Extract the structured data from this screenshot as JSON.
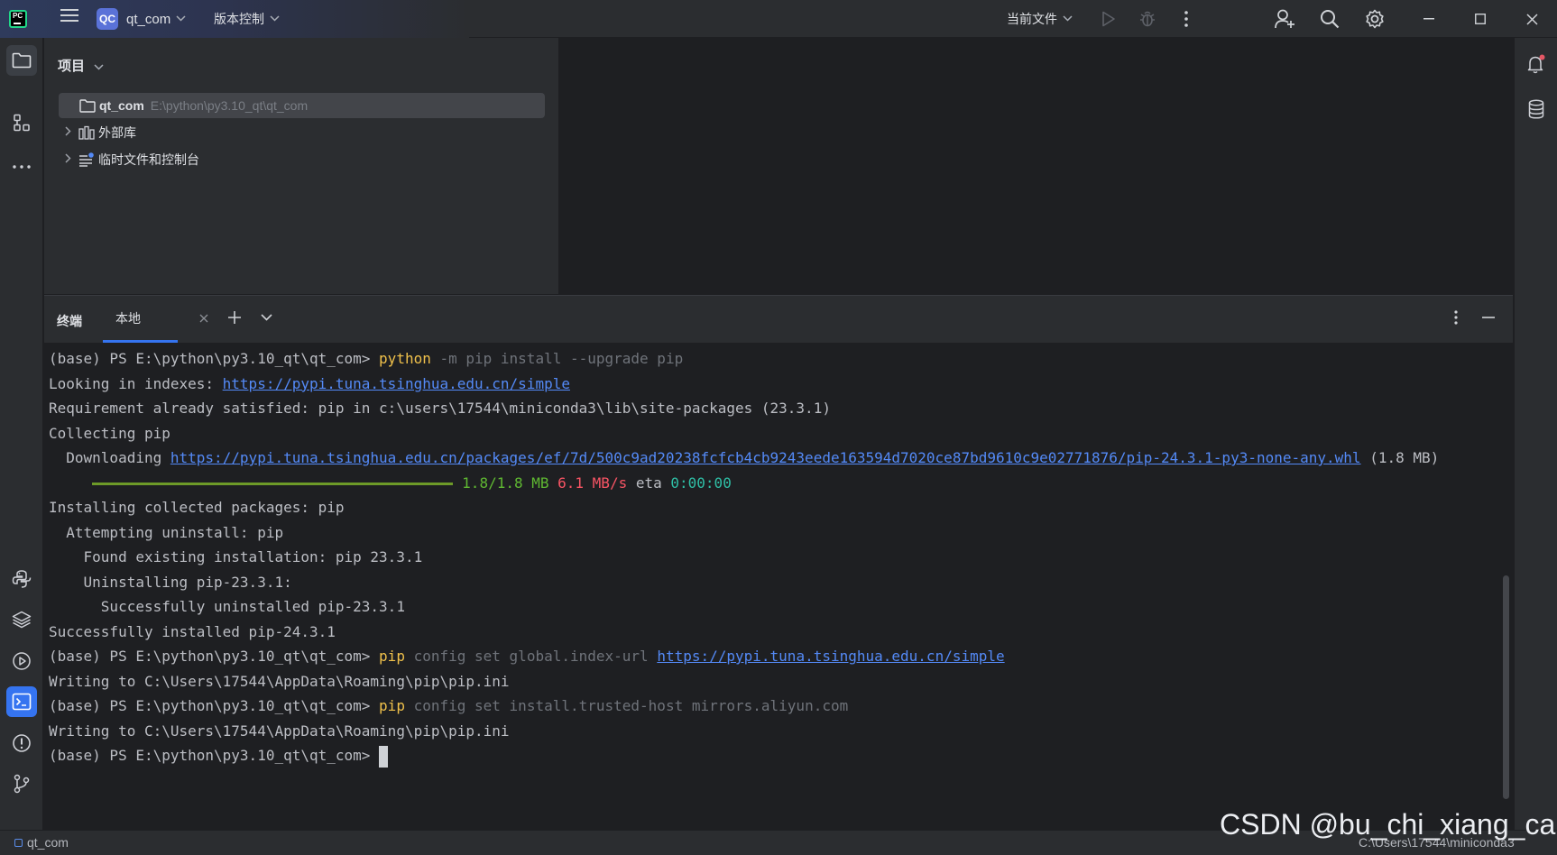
{
  "titlebar": {
    "project_badge": "QC",
    "project_name": "qt_com",
    "vcs_label": "版本控制",
    "current_file_label": "当前文件"
  },
  "project_panel": {
    "title": "项目",
    "tree": [
      {
        "label": "qt_com",
        "path": "E:\\python\\py3.10_qt\\qt_com"
      },
      {
        "label": "外部库"
      },
      {
        "label": "临时文件和控制台"
      }
    ]
  },
  "terminal": {
    "title": "终端",
    "tab_label": "本地",
    "lines": [
      {
        "prompt": "(base) PS E:\\python\\py3.10_qt\\qt_com> ",
        "cmd": "python",
        "args1": " -m ",
        "args2": "pip install ",
        "args3": "--upgrade",
        "args4": " pip"
      },
      {
        "prefix": "Looking in indexes: ",
        "link": "https://pypi.tuna.tsinghua.edu.cn/simple"
      },
      {
        "text": "Requirement already satisfied: pip in c:\\users\\17544\\miniconda3\\lib\\site-packages (23.3.1)"
      },
      {
        "text": "Collecting pip"
      },
      {
        "prefix": "  Downloading ",
        "link": "https://pypi.tuna.tsinghua.edu.cn/packages/ef/7d/500c9ad20238fcfcb4cb9243eede163594d7020ce87bd9610c9e02771876/pip-24.3.1-py3-none-any.whl",
        "suffix": " (1.8 MB)"
      },
      {
        "size": "1.8/1.8 MB",
        "speed": "6.1 MB/s",
        "eta_label": "eta",
        "eta": "0:00:00"
      },
      {
        "text": "Installing collected packages: pip"
      },
      {
        "text": "  Attempting uninstall: pip"
      },
      {
        "text": "    Found existing installation: pip 23.3.1"
      },
      {
        "text": "    Uninstalling pip-23.3.1:"
      },
      {
        "text": "      Successfully uninstalled pip-23.3.1"
      },
      {
        "text": "Successfully installed pip-24.3.1"
      },
      {
        "prompt": "(base) PS E:\\python\\py3.10_qt\\qt_com> ",
        "cmd": "pip",
        "args": " config set global.index-url ",
        "link": "https://pypi.tuna.tsinghua.edu.cn/simple"
      },
      {
        "text": "Writing to C:\\Users\\17544\\AppData\\Roaming\\pip\\pip.ini"
      },
      {
        "prompt": "(base) PS E:\\python\\py3.10_qt\\qt_com> ",
        "cmd": "pip",
        "args": " config set install.trusted-host mirrors.aliyun.com"
      },
      {
        "text": "Writing to C:\\Users\\17544\\AppData\\Roaming\\pip\\pip.ini"
      },
      {
        "prompt": "(base) PS E:\\python\\py3.10_qt\\qt_com> "
      }
    ]
  },
  "statusbar": {
    "project": "qt_com",
    "interpreter_path": "C:\\Users\\17544\\miniconda3"
  },
  "watermark": "CSDN @bu_chi_xiang_cai",
  "colors": {
    "accent": "#3574f0",
    "background": "#1e1f22",
    "panel": "#2b2d30",
    "link": "#548af7",
    "command": "#f0c14b",
    "progress": "#6d9a28"
  },
  "icons": [
    "pycharm-logo",
    "hamburger-menu-icon",
    "chevron-down-icon",
    "run-icon",
    "debug-icon",
    "more-vertical-icon",
    "add-user-icon",
    "search-icon",
    "gear-icon",
    "minimize-icon",
    "maximize-icon",
    "close-icon",
    "folder-icon",
    "structure-icon",
    "more-horizontal-icon",
    "python-console-icon",
    "layers-icon",
    "services-icon",
    "terminal-icon",
    "problems-icon",
    "git-icon",
    "notifications-icon",
    "database-icon",
    "library-icon",
    "scratch-icon"
  ]
}
